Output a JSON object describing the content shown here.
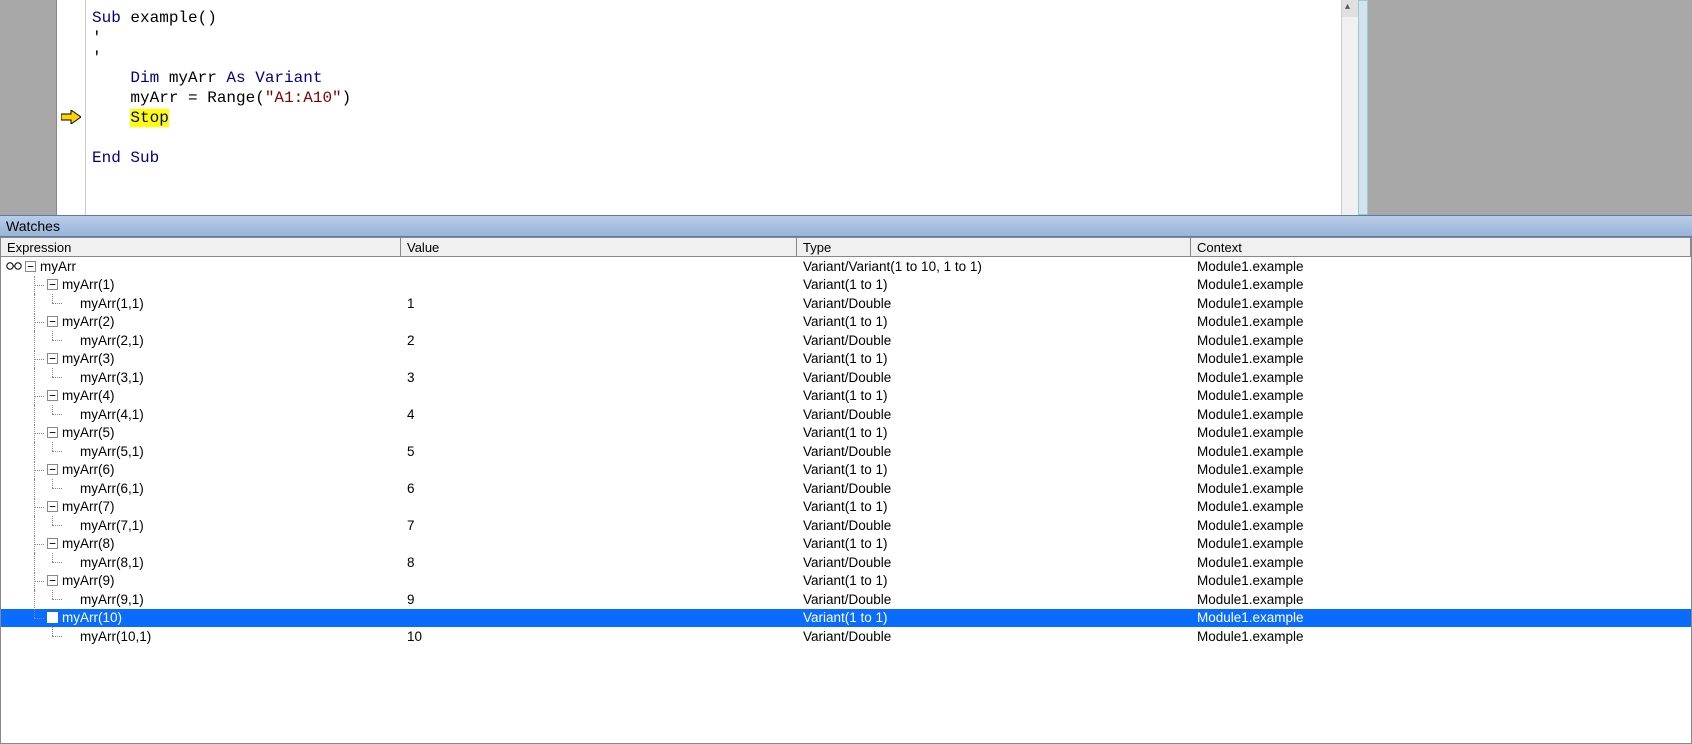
{
  "code": {
    "lines": [
      {
        "segments": [
          {
            "t": "Sub ",
            "c": "kw"
          },
          {
            "t": "example()",
            "c": "lit"
          }
        ]
      },
      {
        "segments": [
          {
            "t": "'",
            "c": "lit"
          }
        ]
      },
      {
        "segments": [
          {
            "t": "'",
            "c": "lit"
          }
        ]
      },
      {
        "segments": [
          {
            "t": "    ",
            "c": ""
          },
          {
            "t": "Dim ",
            "c": "kw"
          },
          {
            "t": "myArr ",
            "c": "lit"
          },
          {
            "t": "As Variant",
            "c": "kw"
          }
        ]
      },
      {
        "segments": [
          {
            "t": "    myArr = Range(",
            "c": "lit"
          },
          {
            "t": "\"A1:A10\"",
            "c": "cstr"
          },
          {
            "t": ")",
            "c": "lit"
          }
        ]
      },
      {
        "segments": [
          {
            "t": "    ",
            "c": ""
          },
          {
            "t": "Stop",
            "c": "hl"
          }
        ],
        "arrow": true
      },
      {
        "segments": []
      },
      {
        "segments": [
          {
            "t": "End Sub",
            "c": "kw"
          }
        ]
      }
    ]
  },
  "watches": {
    "title": "Watches",
    "headers": {
      "expression": "Expression",
      "value": "Value",
      "type": "Type",
      "context": "Context"
    },
    "root": {
      "expr": "myArr",
      "value": "",
      "type": "Variant/Variant(1 to 10, 1 to 1)",
      "context": "Module1.example",
      "level": 0,
      "expander": "-",
      "glasses": true,
      "selected": false
    },
    "items": [
      {
        "idx": 1,
        "outerSelected": false,
        "value": "1"
      },
      {
        "idx": 2,
        "outerSelected": false,
        "value": "2"
      },
      {
        "idx": 3,
        "outerSelected": false,
        "value": "3"
      },
      {
        "idx": 4,
        "outerSelected": false,
        "value": "4"
      },
      {
        "idx": 5,
        "outerSelected": false,
        "value": "5"
      },
      {
        "idx": 6,
        "outerSelected": false,
        "value": "6"
      },
      {
        "idx": 7,
        "outerSelected": false,
        "value": "7"
      },
      {
        "idx": 8,
        "outerSelected": false,
        "value": "8"
      },
      {
        "idx": 9,
        "outerSelected": false,
        "value": "9"
      },
      {
        "idx": 10,
        "outerSelected": true,
        "value": "10"
      }
    ],
    "outerType": "Variant(1 to 1)",
    "leafType": "Variant/Double",
    "context": "Module1.example"
  }
}
